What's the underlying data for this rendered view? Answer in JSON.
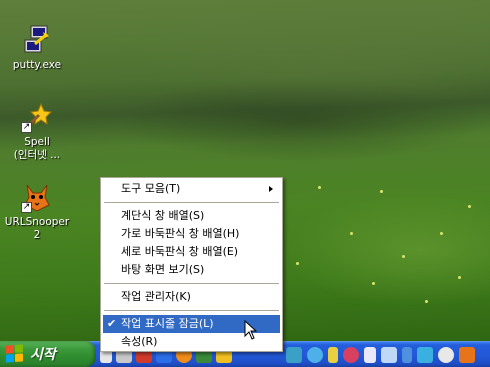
{
  "desktop": {
    "icons": [
      {
        "label": "putty.exe",
        "icon": "putty-icon"
      },
      {
        "label_line1": "Spell",
        "label_line2": "(인터넷 ...",
        "icon": "spell-icon"
      },
      {
        "label_line1": "URLSnooper",
        "label_line2": "2",
        "icon": "urlsnooper-icon"
      }
    ]
  },
  "context_menu": {
    "toolbars": "도구 모음(T)",
    "cascade": "계단식 창 배열(S)",
    "tile_horizontal": "가로 바둑판식 창 배열(H)",
    "tile_vertical": "세로 바둑판식 창 배열(E)",
    "show_desktop": "바탕 화면 보기(S)",
    "task_manager": "작업 관리자(K)",
    "lock_taskbar": "작업 표시줄 잠금(L)",
    "properties": "속성(R)",
    "highlighted_item": "lock_taskbar",
    "highlight_color": "#316ac5"
  },
  "taskbar": {
    "start_label": "시작",
    "start_color": "#3c9a3c",
    "taskbar_color": "#245edb"
  }
}
